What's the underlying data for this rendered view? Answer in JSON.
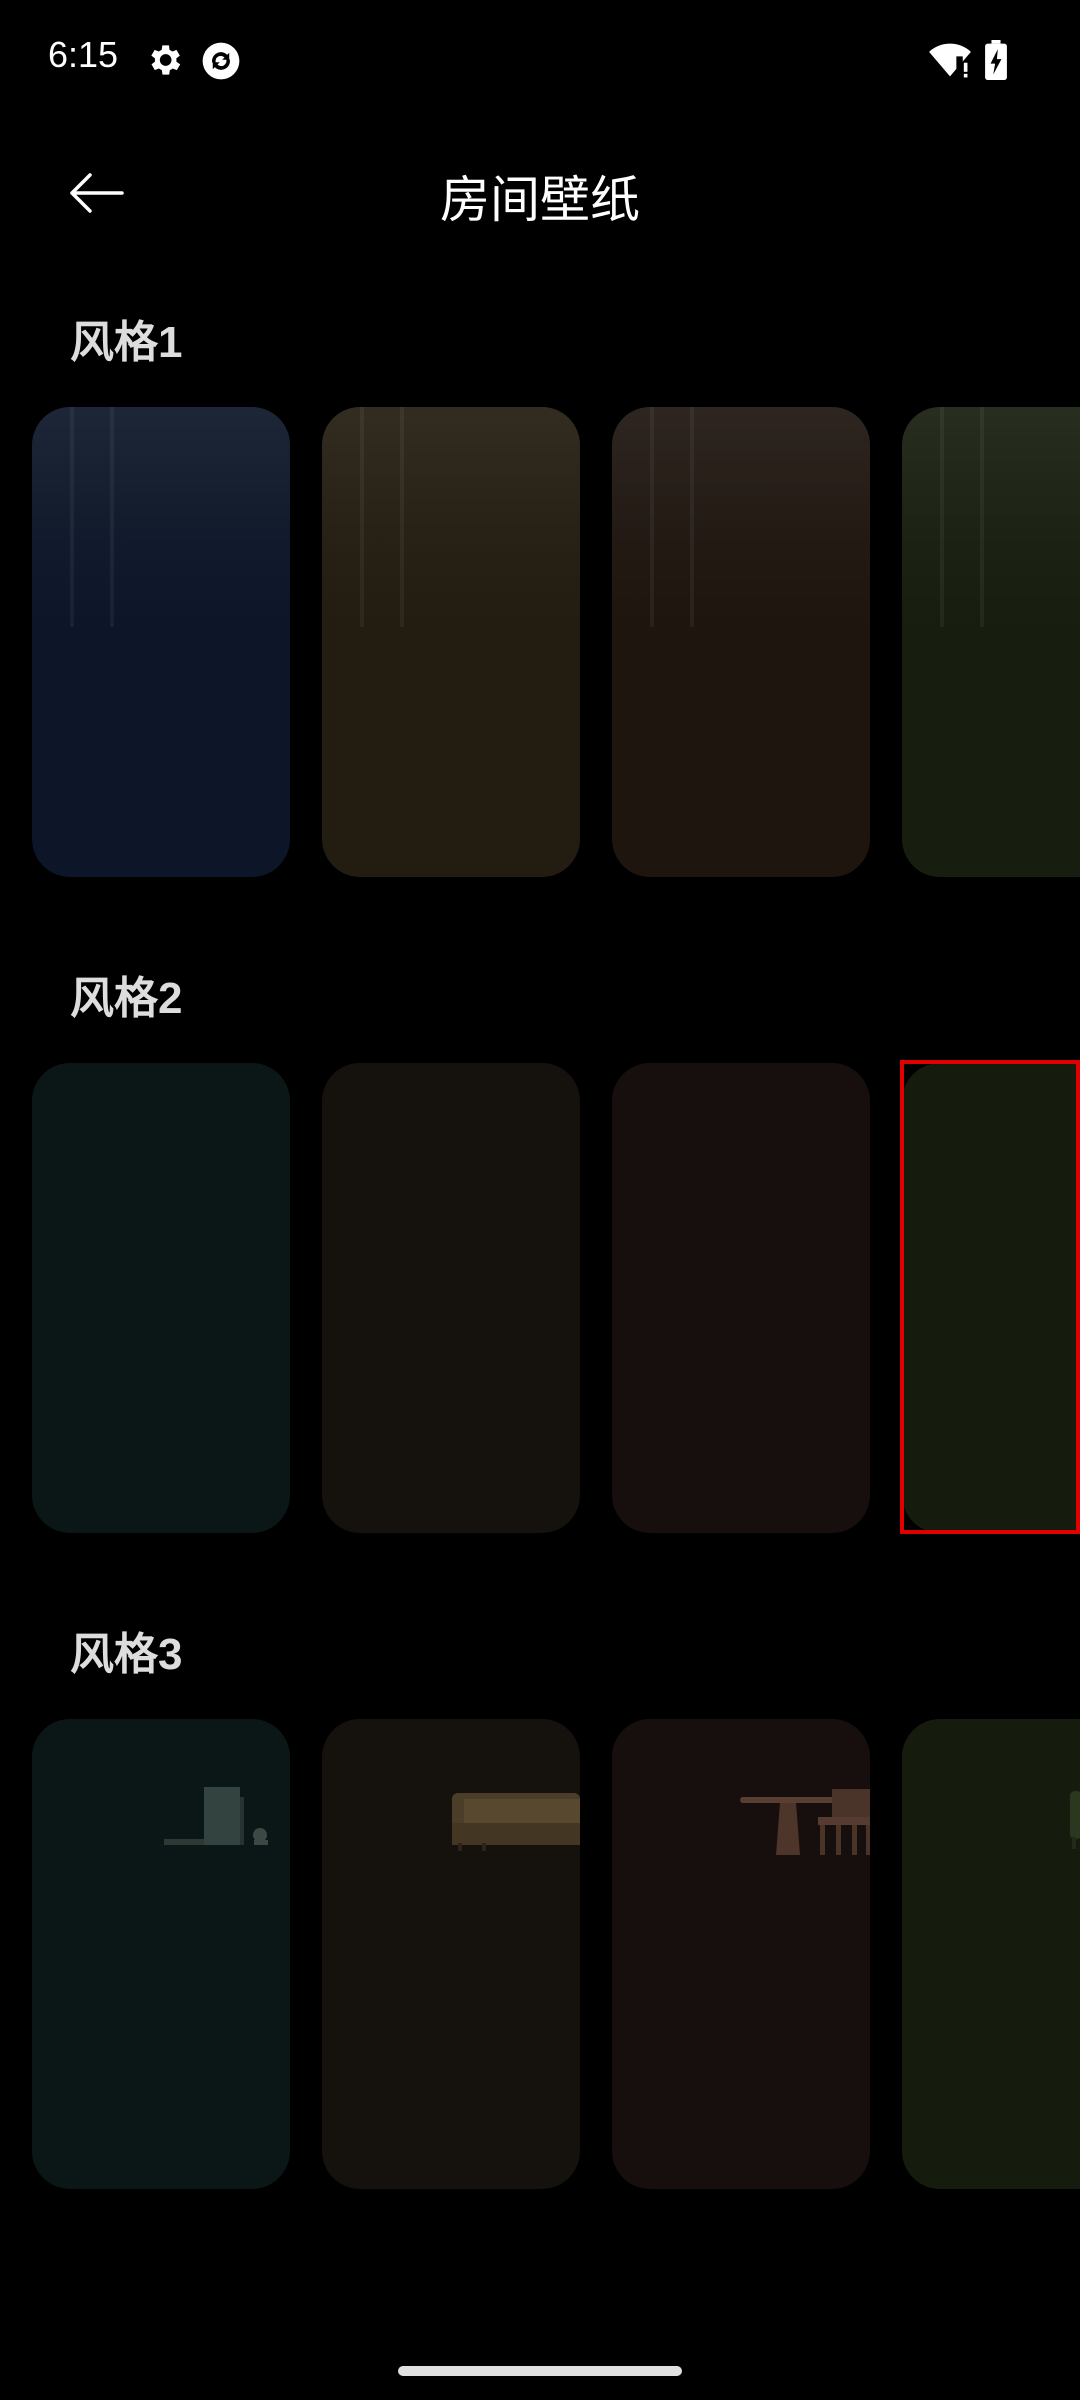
{
  "status_bar": {
    "time": "6:15",
    "icons": [
      "gear-icon",
      "sync-app-icon",
      "wifi-alert-icon",
      "battery-charging-icon"
    ]
  },
  "header": {
    "back_icon": "arrow-left-icon",
    "title": "房间壁纸"
  },
  "sections": [
    {
      "title": "风格1",
      "cards": [
        {
          "color": "#0c1628"
        },
        {
          "color": "#231c10"
        },
        {
          "color": "#1e150f"
        },
        {
          "color": "#171e0f"
        }
      ]
    },
    {
      "title": "风格2",
      "cards": [
        {
          "color": "#0b1716"
        },
        {
          "color": "#15110c"
        },
        {
          "color": "#170f0d"
        },
        {
          "color": "#151b0d"
        }
      ]
    },
    {
      "title": "风格3",
      "cards": [
        {
          "color": "#0b1716"
        },
        {
          "color": "#15110c"
        },
        {
          "color": "#170f0d"
        },
        {
          "color": "#151b0d"
        }
      ]
    }
  ],
  "selection": {
    "color": "#e00000"
  }
}
